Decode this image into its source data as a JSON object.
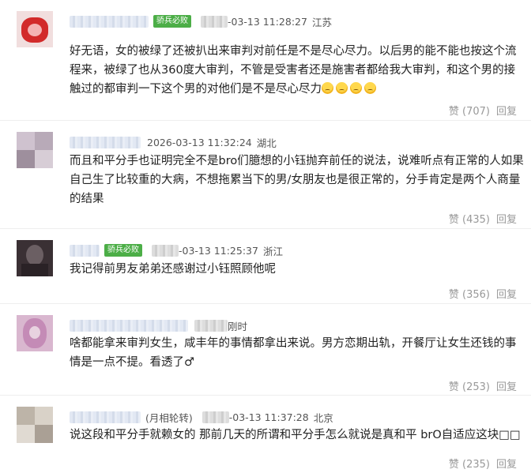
{
  "comments": [
    {
      "badge": "骄兵必败",
      "time": "-03-13 11:28:27",
      "location": "江苏",
      "text": "好无语，女的被绿了还被扒出来审判对前任是不是尽心尽力。以后男的能不能也按这个流程来，被绿了也从360度大审判，不管是受害者还是施害者都给我大审判，和这个男的接触过的都审判一下这个男的对他们是不是尽心尽力",
      "like_label": "赞",
      "likes": "(707)",
      "reply_label": "回复"
    },
    {
      "time": "2026-03-13 11:32:24",
      "location": "湖北",
      "text": "而且和平分手也证明完全不是bro们臆想的小钰抛弃前任的说法，说难听点有正常的人如果自己生了比较重的大病，不想拖累当下的男/女朋友也是很正常的，分手肯定是两个人商量的结果",
      "like_label": "赞",
      "likes": "(435)",
      "reply_label": "回复"
    },
    {
      "badge": "骄兵必败",
      "time": "-03-13 11:25:37",
      "location": "浙江",
      "text": "我记得前男友弟弟还感谢过小钰照顾他呢",
      "like_label": "赞",
      "likes": "(356)",
      "reply_label": "回复"
    },
    {
      "time_suffix": "刚时",
      "text": "啥都能拿来审判女生，咸丰年的事情都拿出来说。男方恋期出轨，开餐厅让女生还钱的事情是一点不提。看透了♂",
      "like_label": "赞",
      "likes": "(253)",
      "reply_label": "回复"
    },
    {
      "caption": "(月相轮转)",
      "time": "-03-13 11:37:28",
      "location": "北京",
      "text": "说这段和平分手就赖女的 那前几天的所谓和平分手怎么就说是真和平 brO自适应这块□□",
      "like_label": "赞",
      "likes": "(235)",
      "reply_label": "回复"
    }
  ],
  "icons": {
    "emoji": "worried-face-icon"
  },
  "colors": {
    "badge_bg": "#4cae47",
    "meta_text": "#555555",
    "action_text": "#999999",
    "divider": "#eeeeee"
  }
}
